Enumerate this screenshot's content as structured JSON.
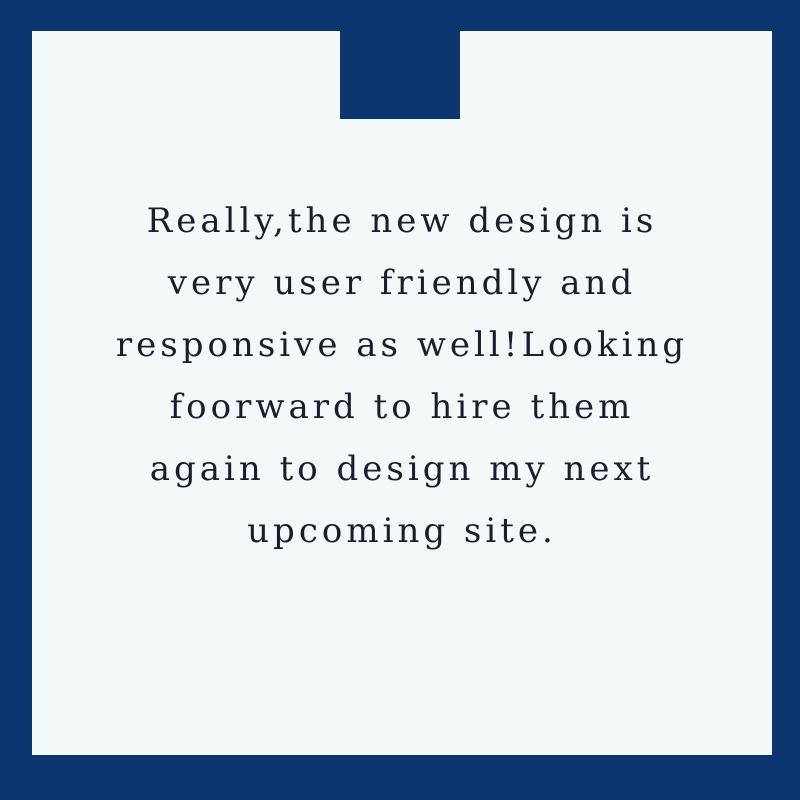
{
  "colors": {
    "frame": "#0b3670",
    "card": "#f3f8f9",
    "text": "#1a1e2c"
  },
  "testimonial": {
    "lines": [
      "Really,the new design is",
      "very user friendly and",
      "responsive as well!Looking",
      "foorward to hire them",
      "again to design my next",
      "upcoming site."
    ]
  }
}
